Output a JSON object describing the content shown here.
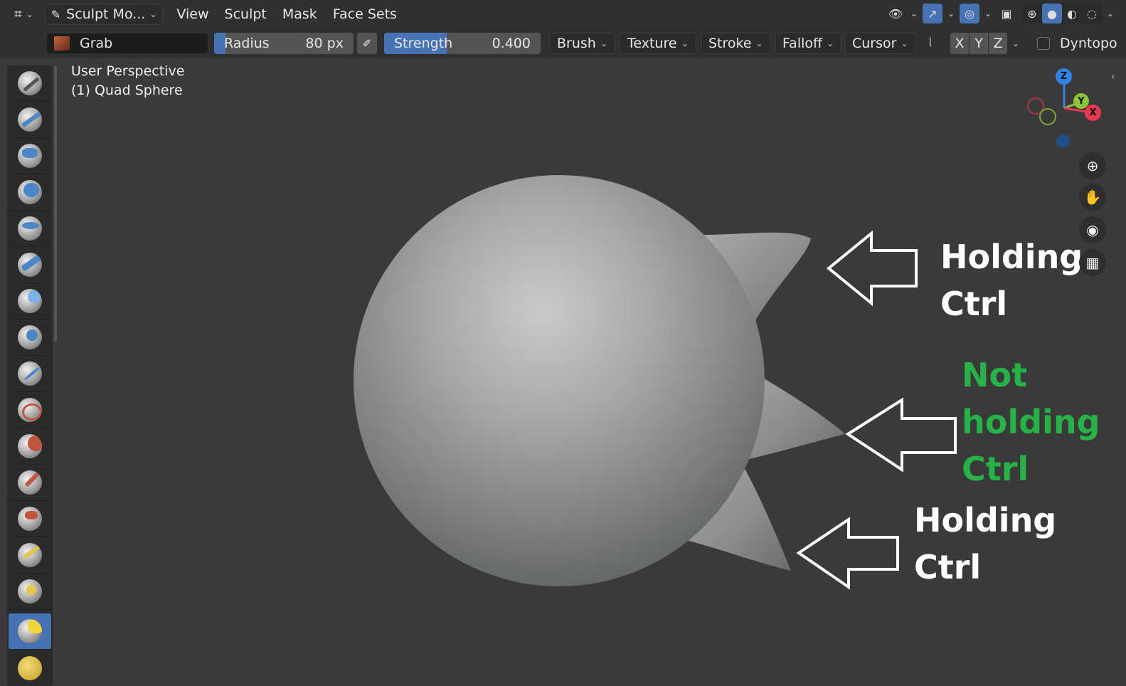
{
  "header": {
    "editor_type_icon": "editor-type-icon",
    "mode": "Sculpt Mo...",
    "menus": [
      "View",
      "Sculpt",
      "Mask",
      "Face Sets"
    ]
  },
  "toolbar": {
    "brush_name": "Grab",
    "radius_label": "Radius",
    "radius_value": "80 px",
    "radius_fill": 0.08,
    "strength_label": "Strength",
    "strength_value": "0.400",
    "strength_fill": 0.4,
    "dropdowns": [
      "Brush",
      "Texture",
      "Stroke",
      "Falloff",
      "Cursor"
    ],
    "symmetry": [
      "X",
      "Y",
      "Z"
    ],
    "dyntopo_label": "Dyntopo"
  },
  "viewport": {
    "view_name": "User Perspective",
    "object_name": "(1) Quad Sphere"
  },
  "gizmo": {
    "z": "Z",
    "y": "Y",
    "x": "X"
  },
  "annotations": {
    "top": [
      "Holding",
      "Ctrl"
    ],
    "middle": [
      "Not",
      "holding",
      "Ctrl"
    ],
    "bottom": [
      "Holding",
      "Ctrl"
    ]
  },
  "colors": {
    "accent": "#4772b3",
    "annotation_white": "#ffffff",
    "annotation_green": "#27b248",
    "axis_x": "#e8384f",
    "axis_y": "#8cc43a",
    "axis_z": "#2f83e4"
  }
}
